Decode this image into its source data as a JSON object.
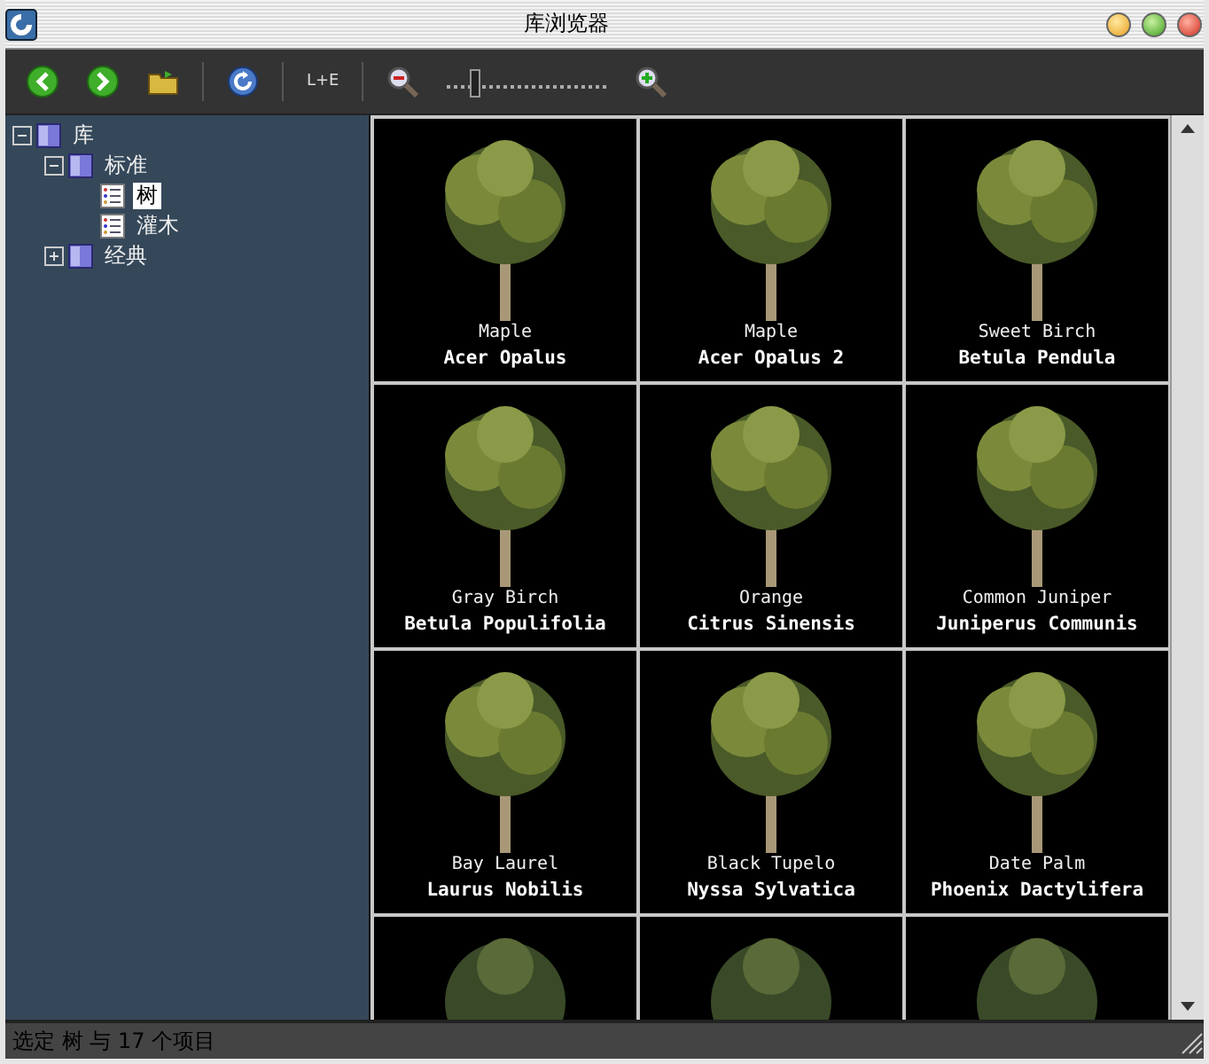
{
  "window": {
    "title": "库浏览器"
  },
  "toolbar": {
    "view_button": "L+E",
    "zoom": {
      "level": 0.18
    }
  },
  "tree": [
    {
      "label": "库",
      "kind": "group",
      "expanded": true,
      "selected": false,
      "children": [
        {
          "label": "标准",
          "kind": "group",
          "expanded": true,
          "selected": false,
          "children": [
            {
              "label": "树",
              "kind": "list",
              "selected": true
            },
            {
              "label": "灌木",
              "kind": "list",
              "selected": false
            }
          ]
        },
        {
          "label": "经典",
          "kind": "group",
          "expanded": false,
          "selected": false
        }
      ]
    }
  ],
  "tiles": [
    {
      "kind": "full",
      "common_name": "Maple",
      "botanical_name": "Acer Opalus"
    },
    {
      "kind": "full",
      "common_name": "Maple",
      "botanical_name": "Acer Opalus 2"
    },
    {
      "kind": "full",
      "common_name": "Sweet Birch",
      "botanical_name": "Betula Pendula"
    },
    {
      "kind": "full",
      "common_name": "Gray Birch",
      "botanical_name": "Betula Populifolia"
    },
    {
      "kind": "full",
      "common_name": "Orange",
      "botanical_name": "Citrus Sinensis"
    },
    {
      "kind": "full",
      "common_name": "Common Juniper",
      "botanical_name": "Juniperus Communis"
    },
    {
      "kind": "full",
      "common_name": "Bay Laurel",
      "botanical_name": "Laurus Nobilis"
    },
    {
      "kind": "full",
      "common_name": "Black Tupelo",
      "botanical_name": "Nyssa Sylvatica"
    },
    {
      "kind": "full",
      "common_name": "Date Palm",
      "botanical_name": "Phoenix Dactylifera"
    },
    {
      "kind": "cut"
    },
    {
      "kind": "cut"
    },
    {
      "kind": "cut"
    }
  ],
  "status_bar": "选定 树 与 17 个项目"
}
